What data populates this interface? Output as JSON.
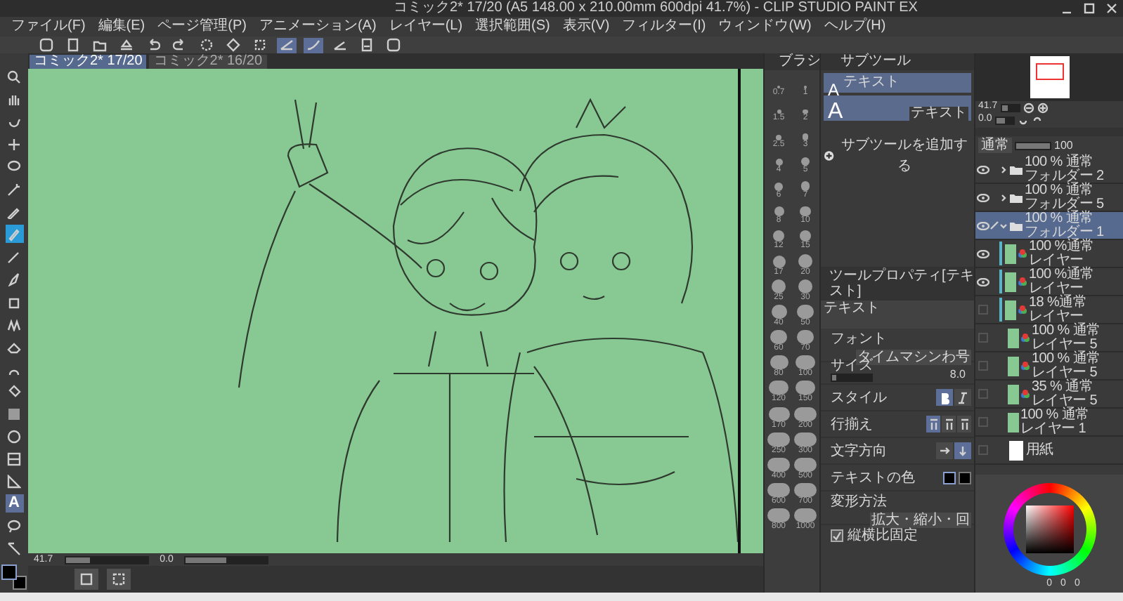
{
  "window": {
    "title": "コミック2* 17/20 (A5 148.00 x 210.00mm 600dpi 41.7%) - CLIP STUDIO PAINT EX"
  },
  "menu": [
    "ファイル(F)",
    "編集(E)",
    "ページ管理(P)",
    "アニメーション(A)",
    "レイヤー(L)",
    "選択範囲(S)",
    "表示(V)",
    "フィルター(I)",
    "ウィンドウ(W)",
    "ヘルプ(H)"
  ],
  "toolbar": [
    {
      "on": false
    },
    {
      "on": false
    },
    {
      "on": false
    },
    {
      "on": false
    },
    {
      "on": false
    },
    {
      "on": false
    },
    {
      "on": false
    },
    {
      "on": false
    },
    {
      "on": false
    },
    {
      "on": true
    },
    {
      "on": true
    },
    {
      "on": false
    },
    {
      "on": false
    },
    {
      "on": false
    }
  ],
  "document_tabs": [
    {
      "label": "コミック2* 17/20",
      "selected": true
    },
    {
      "label": "コミック2* 16/20",
      "selected": false
    }
  ],
  "tools": [
    {
      "selected": false
    },
    {
      "selected": false
    },
    {
      "selected": false
    },
    {
      "selected": false
    },
    {
      "selected": false
    },
    {
      "selected": false
    },
    {
      "selected": false
    },
    {
      "selected": true
    },
    {
      "selected": false
    },
    {
      "selected": false
    },
    {
      "selected": false
    },
    {
      "selected": false
    },
    {
      "selected": false
    },
    {
      "selected": false
    },
    {
      "selected": false
    },
    {
      "selected": false
    },
    {
      "selected": false
    },
    {
      "selected": false
    },
    {
      "selected": false
    },
    {
      "selected": true,
      "glyph": "A"
    },
    {
      "selected": false
    },
    {
      "selected": false
    }
  ],
  "canvas_status": {
    "zoom": {
      "value": "41.7",
      "level": 0.3
    },
    "angle": {
      "value": "0.0",
      "level": 0.5
    }
  },
  "brush_panel": {
    "tab": "ブラシ",
    "sizes": [
      "0.7",
      "1",
      "1.5",
      "2",
      "2.5",
      "3",
      "4",
      "5",
      "6",
      "7",
      "8",
      "10",
      "12",
      "15",
      "17",
      "20",
      "25",
      "30",
      "40",
      "50",
      "60",
      "70",
      "80",
      "100",
      "120",
      "150",
      "170",
      "200",
      "250",
      "300",
      "400",
      "500",
      "600",
      "700",
      "800",
      "1000"
    ]
  },
  "subtool_panel": {
    "tab": "サブツール",
    "items": [
      {
        "kind": "small",
        "glyph": "A",
        "label": "テキスト",
        "selected": true
      },
      {
        "kind": "large",
        "glyph": "A",
        "label": "テキスト",
        "selected": true
      }
    ],
    "add_label": "サブツールを追加する"
  },
  "tool_property": {
    "tab": "ツールプロパティ[テキスト]",
    "tool_name": "テキスト",
    "font_label": "フォント",
    "font": "タイムマシンわ号",
    "size_label": "サイズ",
    "size": {
      "value": "8.0",
      "level": 0.12
    },
    "style_label": "スタイル",
    "bold": true,
    "italic": false,
    "align_label": "行揃え",
    "direction_label": "文字方向",
    "vertical": true,
    "color_label": "テキストの色",
    "transform_label": "変形方法",
    "transform": "拡大・縮小・回",
    "aspect_label": "縦横比固定",
    "aspect_checked": true
  },
  "navigator": {
    "zoom": {
      "value": "41.7",
      "level": 0.4
    },
    "angle": {
      "value": "0.0",
      "level": 0.5
    }
  },
  "layer_panel": {
    "blend": "通常",
    "opacity": {
      "value": "100",
      "level": 1
    },
    "layers": [
      {
        "kind": "folder",
        "mode": "100 % 通常",
        "name": "フォルダー 2",
        "visible": true,
        "selected": false,
        "expanded": false
      },
      {
        "kind": "folder",
        "mode": "100 % 通常",
        "name": "フォルダー 5",
        "visible": true,
        "selected": false,
        "expanded": false
      },
      {
        "kind": "folder",
        "mode": "100 % 通常",
        "name": "フォルダー 1",
        "visible": true,
        "selected": true,
        "expanded": true,
        "children": [
          {
            "kind": "layer",
            "mode": "100 %通常",
            "name": "レイヤー",
            "visible": true,
            "selected": false
          },
          {
            "kind": "layer",
            "mode": "100 %通常",
            "name": "レイヤー",
            "visible": true,
            "selected": false
          },
          {
            "kind": "layer",
            "mode": "18 %通常",
            "name": "レイヤー",
            "visible": false,
            "selected": false
          }
        ]
      },
      {
        "kind": "layer",
        "mode": "100 % 通常",
        "name": "レイヤー 5",
        "visible": false,
        "selected": false
      },
      {
        "kind": "layer",
        "mode": "100 % 通常",
        "name": "レイヤー 5",
        "visible": false,
        "selected": false
      },
      {
        "kind": "layer",
        "mode": "35 % 通常",
        "name": "レイヤー 5",
        "visible": false,
        "selected": false
      },
      {
        "kind": "plain",
        "mode": "100 % 通常",
        "name": "レイヤー 1",
        "visible": false,
        "selected": false
      },
      {
        "kind": "paper",
        "name": "用紙",
        "visible": false,
        "selected": false
      }
    ]
  },
  "color_panel": {
    "values": [
      "0",
      "0",
      "0"
    ]
  }
}
